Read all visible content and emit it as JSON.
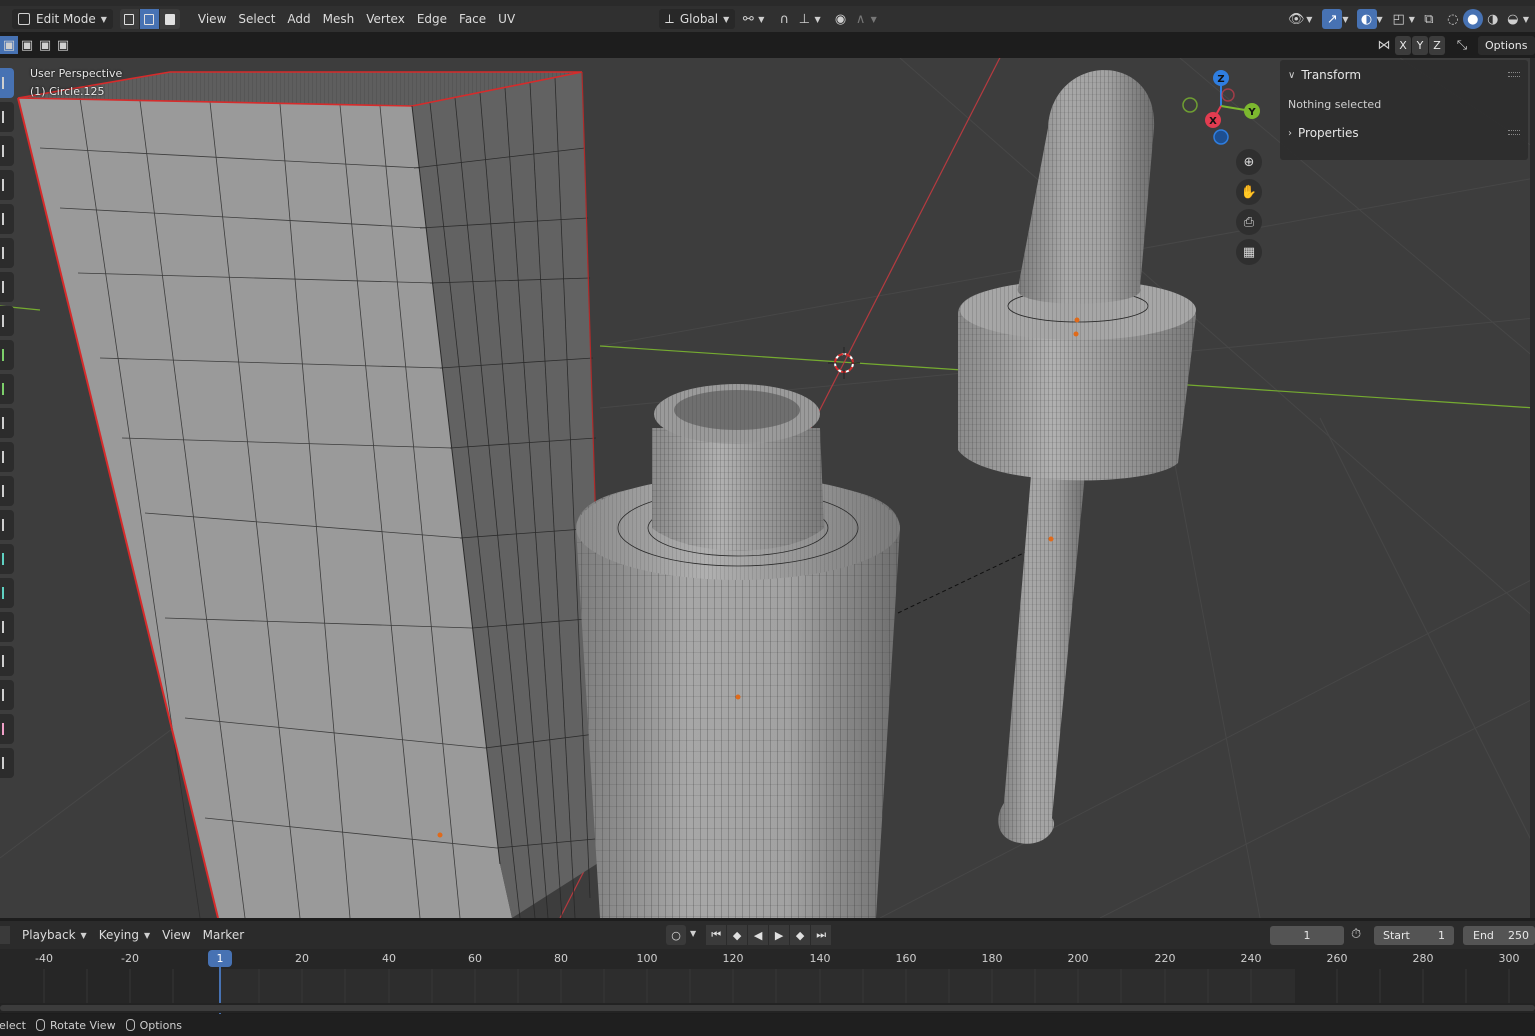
{
  "header": {
    "mode_label": "Edit Mode",
    "menus": [
      "View",
      "Select",
      "Add",
      "Mesh",
      "Vertex",
      "Edge",
      "Face",
      "UV"
    ],
    "transform_orientation": "Global"
  },
  "subheader": {
    "axes": [
      "X",
      "Y",
      "Z"
    ],
    "options_label": "Options"
  },
  "viewport": {
    "view_name": "User Perspective",
    "object_name": "(1) Circle.125",
    "gizmo_axes": {
      "z": "Z",
      "y": "Y",
      "x": "X"
    },
    "colors": {
      "x_axis": "#e23c50",
      "y_axis": "#7cb82f",
      "z_axis": "#2f7ee0",
      "background": "#3d3d3d"
    }
  },
  "npanel": {
    "transform_label": "Transform",
    "nothing_selected": "Nothing selected",
    "properties_label": "Properties"
  },
  "timeline": {
    "menus": [
      "Playback",
      "Keying",
      "View",
      "Marker"
    ],
    "current_frame": "1",
    "start_label": "Start",
    "start_value": "1",
    "end_label": "End",
    "end_value": "250",
    "ticks": [
      "-40",
      "-20",
      "1",
      "20",
      "40",
      "60",
      "80",
      "100",
      "120",
      "140",
      "160",
      "180",
      "200",
      "220",
      "240",
      "260",
      "280",
      "300"
    ]
  },
  "statusbar": {
    "items": [
      "elect",
      "Rotate View",
      "Options"
    ]
  }
}
